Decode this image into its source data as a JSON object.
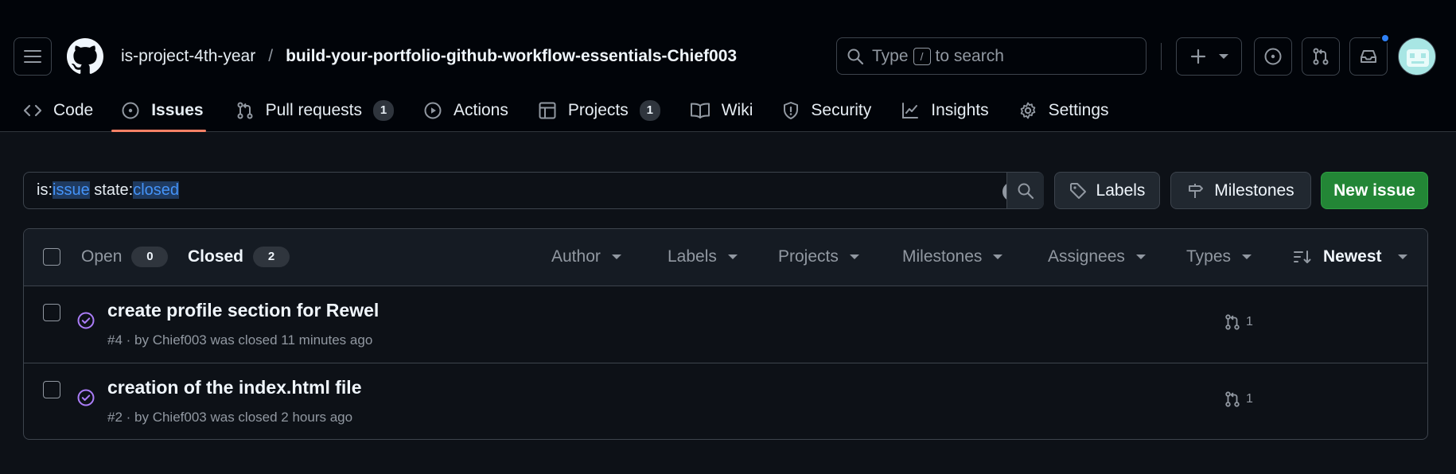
{
  "header": {
    "owner": "is-project-4th-year",
    "separator": "/",
    "repo": "build-your-portfolio-github-workflow-essentials-Chief003",
    "search": {
      "prefix": "Type",
      "key": "/",
      "suffix": "to search"
    }
  },
  "tabs": [
    {
      "label": "Code",
      "icon": "code-icon"
    },
    {
      "label": "Issues",
      "icon": "issue-opened-icon",
      "active": true
    },
    {
      "label": "Pull requests",
      "icon": "git-pull-request-icon",
      "count": "1"
    },
    {
      "label": "Actions",
      "icon": "play-icon"
    },
    {
      "label": "Projects",
      "icon": "table-icon",
      "count": "1"
    },
    {
      "label": "Wiki",
      "icon": "book-icon"
    },
    {
      "label": "Security",
      "icon": "shield-icon"
    },
    {
      "label": "Insights",
      "icon": "graph-icon"
    },
    {
      "label": "Settings",
      "icon": "gear-icon"
    }
  ],
  "filter": {
    "is_key": "is:",
    "is_value": "issue",
    "state_key": "state:",
    "state_value": "closed"
  },
  "buttons": {
    "labels": "Labels",
    "milestones": "Milestones",
    "new_issue": "New issue"
  },
  "list": {
    "open_label": "Open",
    "open_count": "0",
    "closed_label": "Closed",
    "closed_count": "2",
    "filters": [
      "Author",
      "Labels",
      "Projects",
      "Milestones",
      "Assignees",
      "Types"
    ],
    "sort": "Newest",
    "issues": [
      {
        "title": "create profile section for Rewel",
        "meta": "#4 · by Chief003 was closed 11 minutes ago",
        "pr_count": "1"
      },
      {
        "title": "creation of the index.html file",
        "meta": "#2 · by Chief003 was closed 2 hours ago",
        "pr_count": "1"
      }
    ]
  },
  "colors": {
    "accent_tab": "#f78166",
    "green": "#238636",
    "closed_purple": "#ab7df8",
    "link_blue": "#4493f8"
  }
}
